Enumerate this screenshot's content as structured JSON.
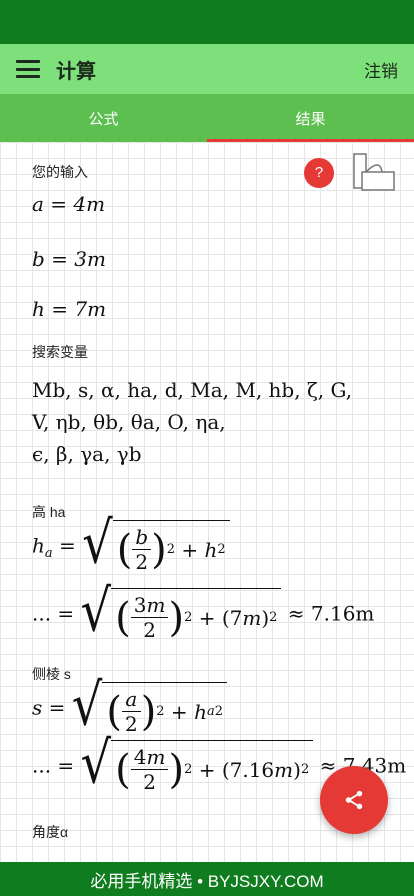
{
  "app": {
    "title": "计算",
    "logout_label": "注销"
  },
  "tabs": [
    {
      "label": "公式"
    },
    {
      "label": "结果"
    }
  ],
  "content": {
    "help_symbol": "?",
    "inputs_label": "您的输入",
    "inputs": [
      {
        "var": "a",
        "value": "4m"
      },
      {
        "var": "b",
        "value": "3m"
      },
      {
        "var": "h",
        "value": "7m"
      }
    ],
    "search_vars_label": "搜索变量",
    "search_vars_lines": [
      "Mb, s, α, ha, d, Ma, M, hb, ζ, G,",
      "V, ηb, θb, θa, O, ηa,",
      "ϵ, β, γa, γb"
    ],
    "height_label": "高 ha",
    "height_result": "≈ 7.16m",
    "edge_label": "侧棱 s",
    "edge_result": "≈ 7.43m",
    "angle_label": "角度α"
  },
  "footer": {
    "watermark": "必用手机精选 • BYJSJXY.COM"
  },
  "colors": {
    "status_bar": "#0f7d1f",
    "app_bar": "#7ee07a",
    "tab_bar": "#5dbf4f",
    "accent": "#e53935"
  }
}
